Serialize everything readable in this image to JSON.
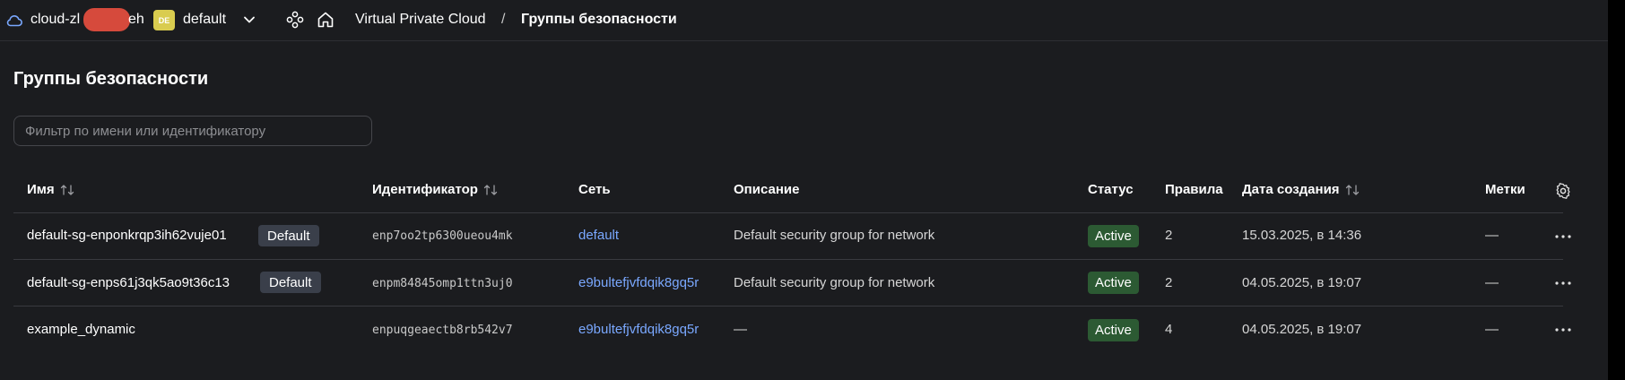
{
  "header": {
    "cloud_name_prefix": "cloud-zl",
    "cloud_name_suffix": "eh",
    "folder_badge": "DE",
    "folder_name": "default",
    "breadcrumb_vpc": "Virtual Private Cloud",
    "breadcrumb_sep": "/",
    "breadcrumb_current": "Группы безопасности"
  },
  "page": {
    "title": "Группы безопасности",
    "filter_placeholder": "Фильтр по имени или идентификатору",
    "filter_value": ""
  },
  "table": {
    "columns": {
      "name": "Имя",
      "id": "Идентификатор",
      "network": "Сеть",
      "description": "Описание",
      "status": "Статус",
      "rules": "Правила",
      "created": "Дата создания",
      "labels": "Метки"
    },
    "rows": [
      {
        "name": "default-sg-enponkrqp3ih62vuje01",
        "badge": "Default",
        "id": "enp7oo2tp6300ueou4mk",
        "network": "default",
        "description": "Default security group for network",
        "status": "Active",
        "rules": "2",
        "created": "15.03.2025, в 14:36",
        "labels": "—"
      },
      {
        "name": "default-sg-enps61j3qk5ao9t36c13",
        "badge": "Default",
        "id": "enpm84845omp1ttn3uj0",
        "network": "e9bultefjvfdqik8gq5r",
        "description": "Default security group for network",
        "status": "Active",
        "rules": "2",
        "created": "04.05.2025, в 19:07",
        "labels": "—"
      },
      {
        "name": "example_dynamic",
        "badge": "",
        "id": "enpuqgeaectb8rb542v7",
        "network": "e9bultefjvfdqik8gq5r",
        "description": "—",
        "status": "Active",
        "rules": "4",
        "created": "04.05.2025, в 19:07",
        "labels": "—"
      }
    ]
  },
  "colors": {
    "background": "#1b1c1f",
    "link": "#7aa8ff",
    "active_badge": "#2c5a33",
    "default_badge": "#3a3f4a",
    "folder_badge": "#d9cc4f",
    "redaction": "#d64a3c"
  },
  "icons": {
    "cloud": "cloud-icon",
    "chevron": "chevron-down-icon",
    "nodes": "nodes-icon",
    "home": "home-icon",
    "sort": "sort-icon",
    "gear": "gear-icon",
    "more": "more-icon"
  }
}
